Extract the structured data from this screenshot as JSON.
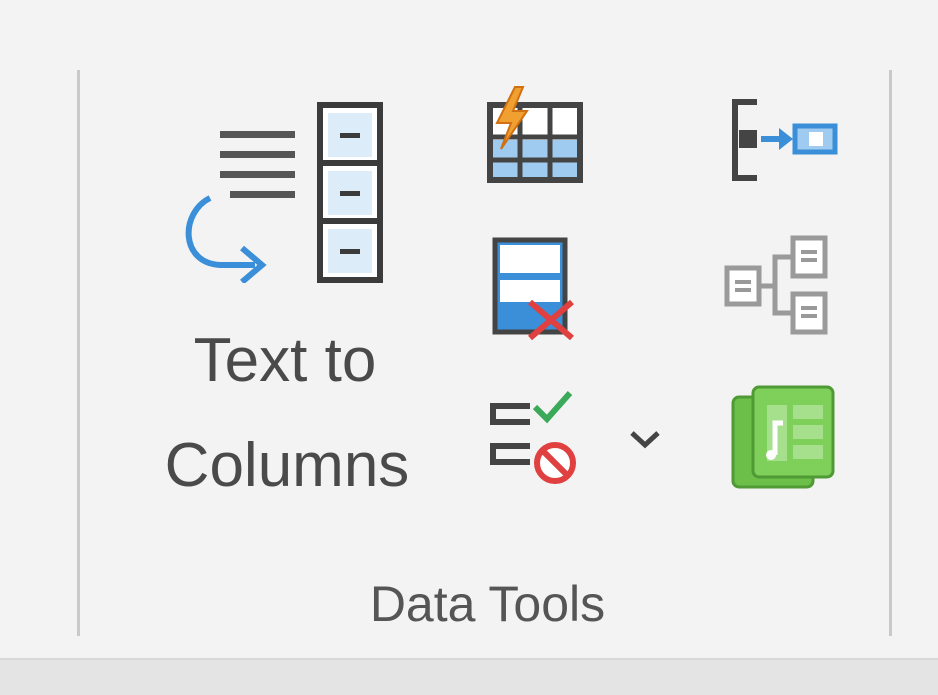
{
  "group": {
    "label": "Data Tools"
  },
  "buttons": {
    "text_to_columns": {
      "line1": "Text to",
      "line2": "Columns"
    },
    "flash_fill_icon": "flash-fill-icon",
    "remove_duplicates_icon": "remove-duplicates-icon",
    "data_validation_icon": "data-validation-icon",
    "consolidate_icon": "consolidate-icon",
    "relationships_icon": "relationships-icon",
    "manage_data_model_icon": "manage-data-model-icon"
  },
  "colors": {
    "accent_blue": "#3a8fd8",
    "error_red": "#e04040",
    "check_green": "#3aaa5a",
    "data_model_green": "#6cc04a",
    "icon_dark": "#444444"
  }
}
